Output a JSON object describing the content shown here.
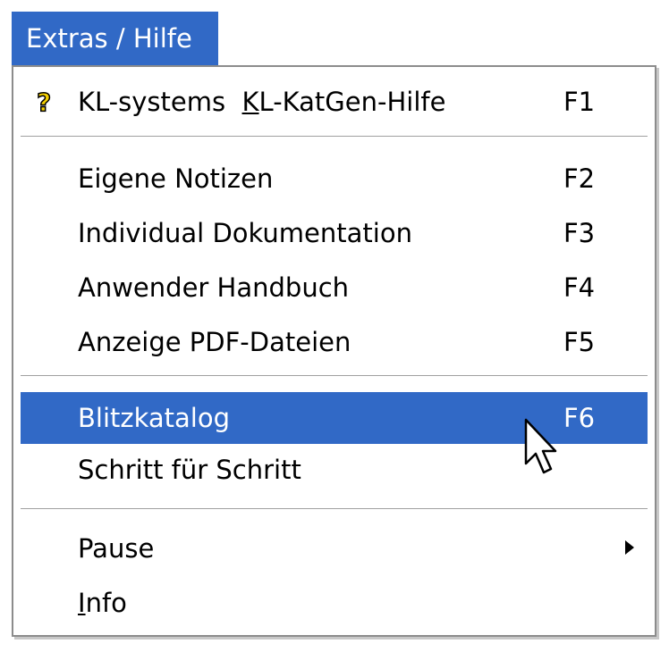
{
  "menubar": {
    "label": "Extras / Hilfe"
  },
  "menu": {
    "help_item": {
      "label_prefix": "KL-systems  ",
      "label_underlined": "K",
      "label_rest": "L-KatGen-Hilfe",
      "shortcut": "F1",
      "icon": "help-question-icon"
    },
    "items": [
      {
        "label": "Eigene Notizen",
        "shortcut": "F2"
      },
      {
        "label": "Individual Dokumentation",
        "shortcut": "F3"
      },
      {
        "label": "Anwender Handbuch",
        "shortcut": "F4"
      },
      {
        "label": "Anzeige PDF-Dateien",
        "shortcut": "F5"
      }
    ],
    "blitz": {
      "label": "Blitzkatalog",
      "shortcut": "F6"
    },
    "schritt": {
      "label": "Schritt für Schritt"
    },
    "pause": {
      "label": "Pause"
    },
    "info": {
      "label_underlined": "I",
      "label_rest": "nfo"
    }
  },
  "colors": {
    "highlight": "#3169c6",
    "highlight_text": "#ffffff"
  }
}
